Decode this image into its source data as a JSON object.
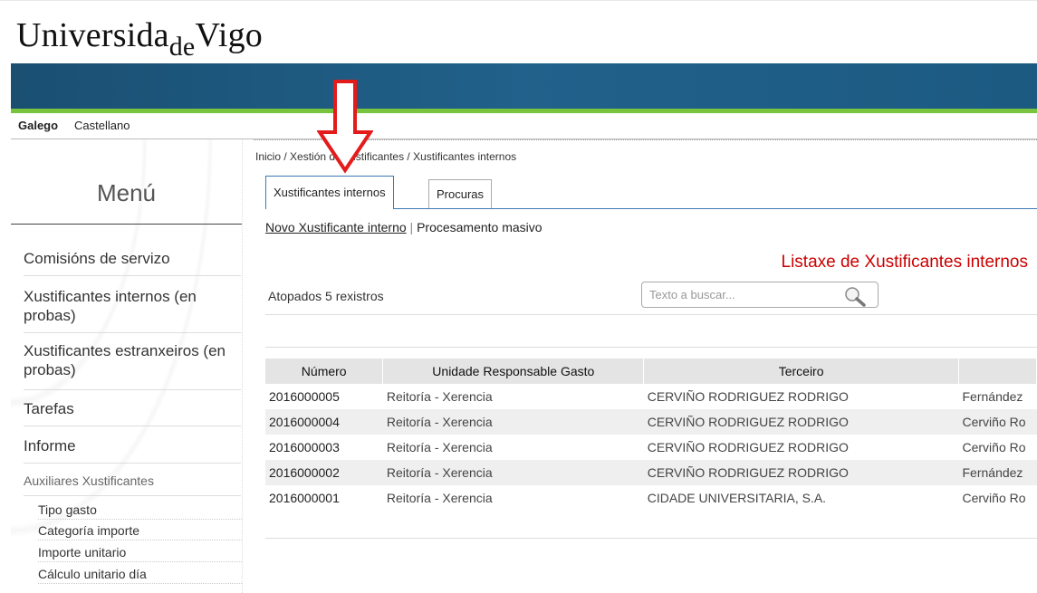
{
  "logo": {
    "part1": "Universida",
    "part2": "de",
    "part3": "Vigo"
  },
  "languages": {
    "galego": "Galego",
    "castellano": "Castellano"
  },
  "breadcrumb": "Inicio / Xestión de xustificantes / Xustificantes internos",
  "tabs": [
    {
      "label": "Xustificantes internos"
    },
    {
      "label": "Procuras"
    }
  ],
  "links": {
    "new": "Novo Xustificante interno",
    "separator": "|",
    "bulk": "Procesamento masivo"
  },
  "list_title": "Listaxe de Xustificantes internos",
  "found_text": "Atopados 5 rexistros",
  "search": {
    "placeholder": "Texto a buscar..."
  },
  "sidebar": {
    "title": "Menú",
    "items": [
      {
        "label": "Comisións de servizo"
      },
      {
        "label": "Xustificantes internos (en probas)"
      },
      {
        "label": "Xustificantes estranxeiros (en probas)"
      },
      {
        "label": "Tarefas"
      },
      {
        "label": "Informe"
      }
    ],
    "aux_heading": "Auxiliares Xustificantes",
    "sub_items": [
      {
        "label": "Tipo gasto"
      },
      {
        "label": "Categoría importe"
      },
      {
        "label": "Importe unitario"
      },
      {
        "label": "Cálculo unitario día"
      }
    ]
  },
  "table": {
    "headers": [
      "Número",
      "Unidade Responsable Gasto",
      "Terceiro",
      ""
    ],
    "rows": [
      [
        "2016000005",
        "Reitoría - Xerencia",
        "CERVIÑO RODRIGUEZ RODRIGO",
        "Fernández"
      ],
      [
        "2016000004",
        "Reitoría - Xerencia",
        "CERVIÑO RODRIGUEZ RODRIGO",
        "Cerviño Ro"
      ],
      [
        "2016000003",
        "Reitoría - Xerencia",
        "CERVIÑO RODRIGUEZ RODRIGO",
        "Cerviño Ro"
      ],
      [
        "2016000002",
        "Reitoría - Xerencia",
        "CERVIÑO RODRIGUEZ RODRIGO",
        "Fernández"
      ],
      [
        "2016000001",
        "Reitoría - Xerencia",
        "CIDADE UNIVERSITARIA, S.A.",
        "Cerviño Ro"
      ]
    ]
  },
  "colors": {
    "banner": "#21618a",
    "stripe": "#79c43f",
    "title_red": "#cc0000",
    "tab_border": "#3a7ab5",
    "arrow": "#e31b1b"
  }
}
